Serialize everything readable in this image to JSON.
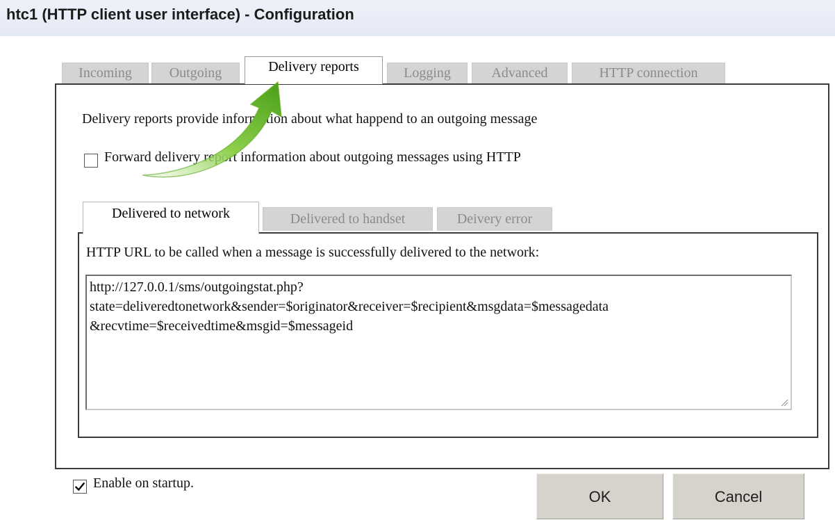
{
  "window": {
    "title": "htc1 (HTTP client user interface) - Configuration"
  },
  "tabs": [
    {
      "label": "Incoming",
      "active": false
    },
    {
      "label": "Outgoing",
      "active": false
    },
    {
      "label": "Delivery reports",
      "active": true
    },
    {
      "label": "Logging",
      "active": false
    },
    {
      "label": "Advanced",
      "active": false
    },
    {
      "label": "HTTP connection",
      "active": false
    }
  ],
  "delivery_reports": {
    "description": "Delivery reports provide information about what happend to an outgoing message",
    "forward_checkbox": {
      "label": "Forward delivery report information about outgoing messages using HTTP",
      "checked": false
    },
    "sub_tabs": [
      {
        "label": "Delivered to network",
        "active": true
      },
      {
        "label": "Delivered to handset",
        "active": false
      },
      {
        "label": "Deivery error",
        "active": false
      }
    ],
    "url_label": "HTTP URL to be called when a message is successfully delivered to the network:",
    "url_value": "http://127.0.0.1/sms/outgoingstat.php?\nstate=deliveredtonetwork&sender=$originator&receiver=$recipient&msgdata=$messagedata\n&recvtime=$receivedtime&msgid=$messageid"
  },
  "footer": {
    "enable_checkbox": {
      "label": "Enable on startup.",
      "checked": true
    },
    "ok_label": "OK",
    "cancel_label": "Cancel"
  },
  "colors": {
    "title_bar": "#e4e9f5",
    "inactive_tab": "#d4d4d4",
    "button_face": "#d6d2cc",
    "arrow_green": "#6cc02a"
  },
  "icons": {
    "pointer_arrow": "green-curved-arrow-icon",
    "checkmark": "checkmark-icon",
    "resize_grip": "resize-grip-icon"
  }
}
